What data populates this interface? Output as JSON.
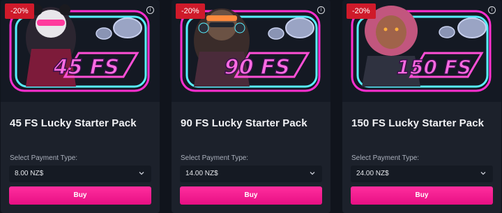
{
  "cards": [
    {
      "discount": "-20%",
      "art_text": "45 FS",
      "character": "panda",
      "title": "45 FS Lucky Starter Pack",
      "payment_label": "Select Payment Type:",
      "payment_value": "8.00 NZ$",
      "buy_label": "Buy"
    },
    {
      "discount": "-20%",
      "art_text": "90 FS",
      "character": "monkey",
      "title": "90 FS Lucky Starter Pack",
      "payment_label": "Select Payment Type:",
      "payment_value": "14.00 NZ$",
      "buy_label": "Buy"
    },
    {
      "discount": "-20%",
      "art_text": "150 FS",
      "character": "lion",
      "title": "150 FS Lucky Starter Pack",
      "payment_label": "Select Payment Type:",
      "payment_value": "24.00 NZ$",
      "buy_label": "Buy"
    }
  ],
  "icons": {
    "info": "info-icon",
    "chevron": "chevron-down-icon"
  },
  "colors": {
    "page_bg": "#10141c",
    "card_bg": "#1c212b",
    "badge": "#cf1a2a",
    "buy": "#ff1f93",
    "neon_pink": "#ff2fd0",
    "neon_cyan": "#58f0ff"
  }
}
